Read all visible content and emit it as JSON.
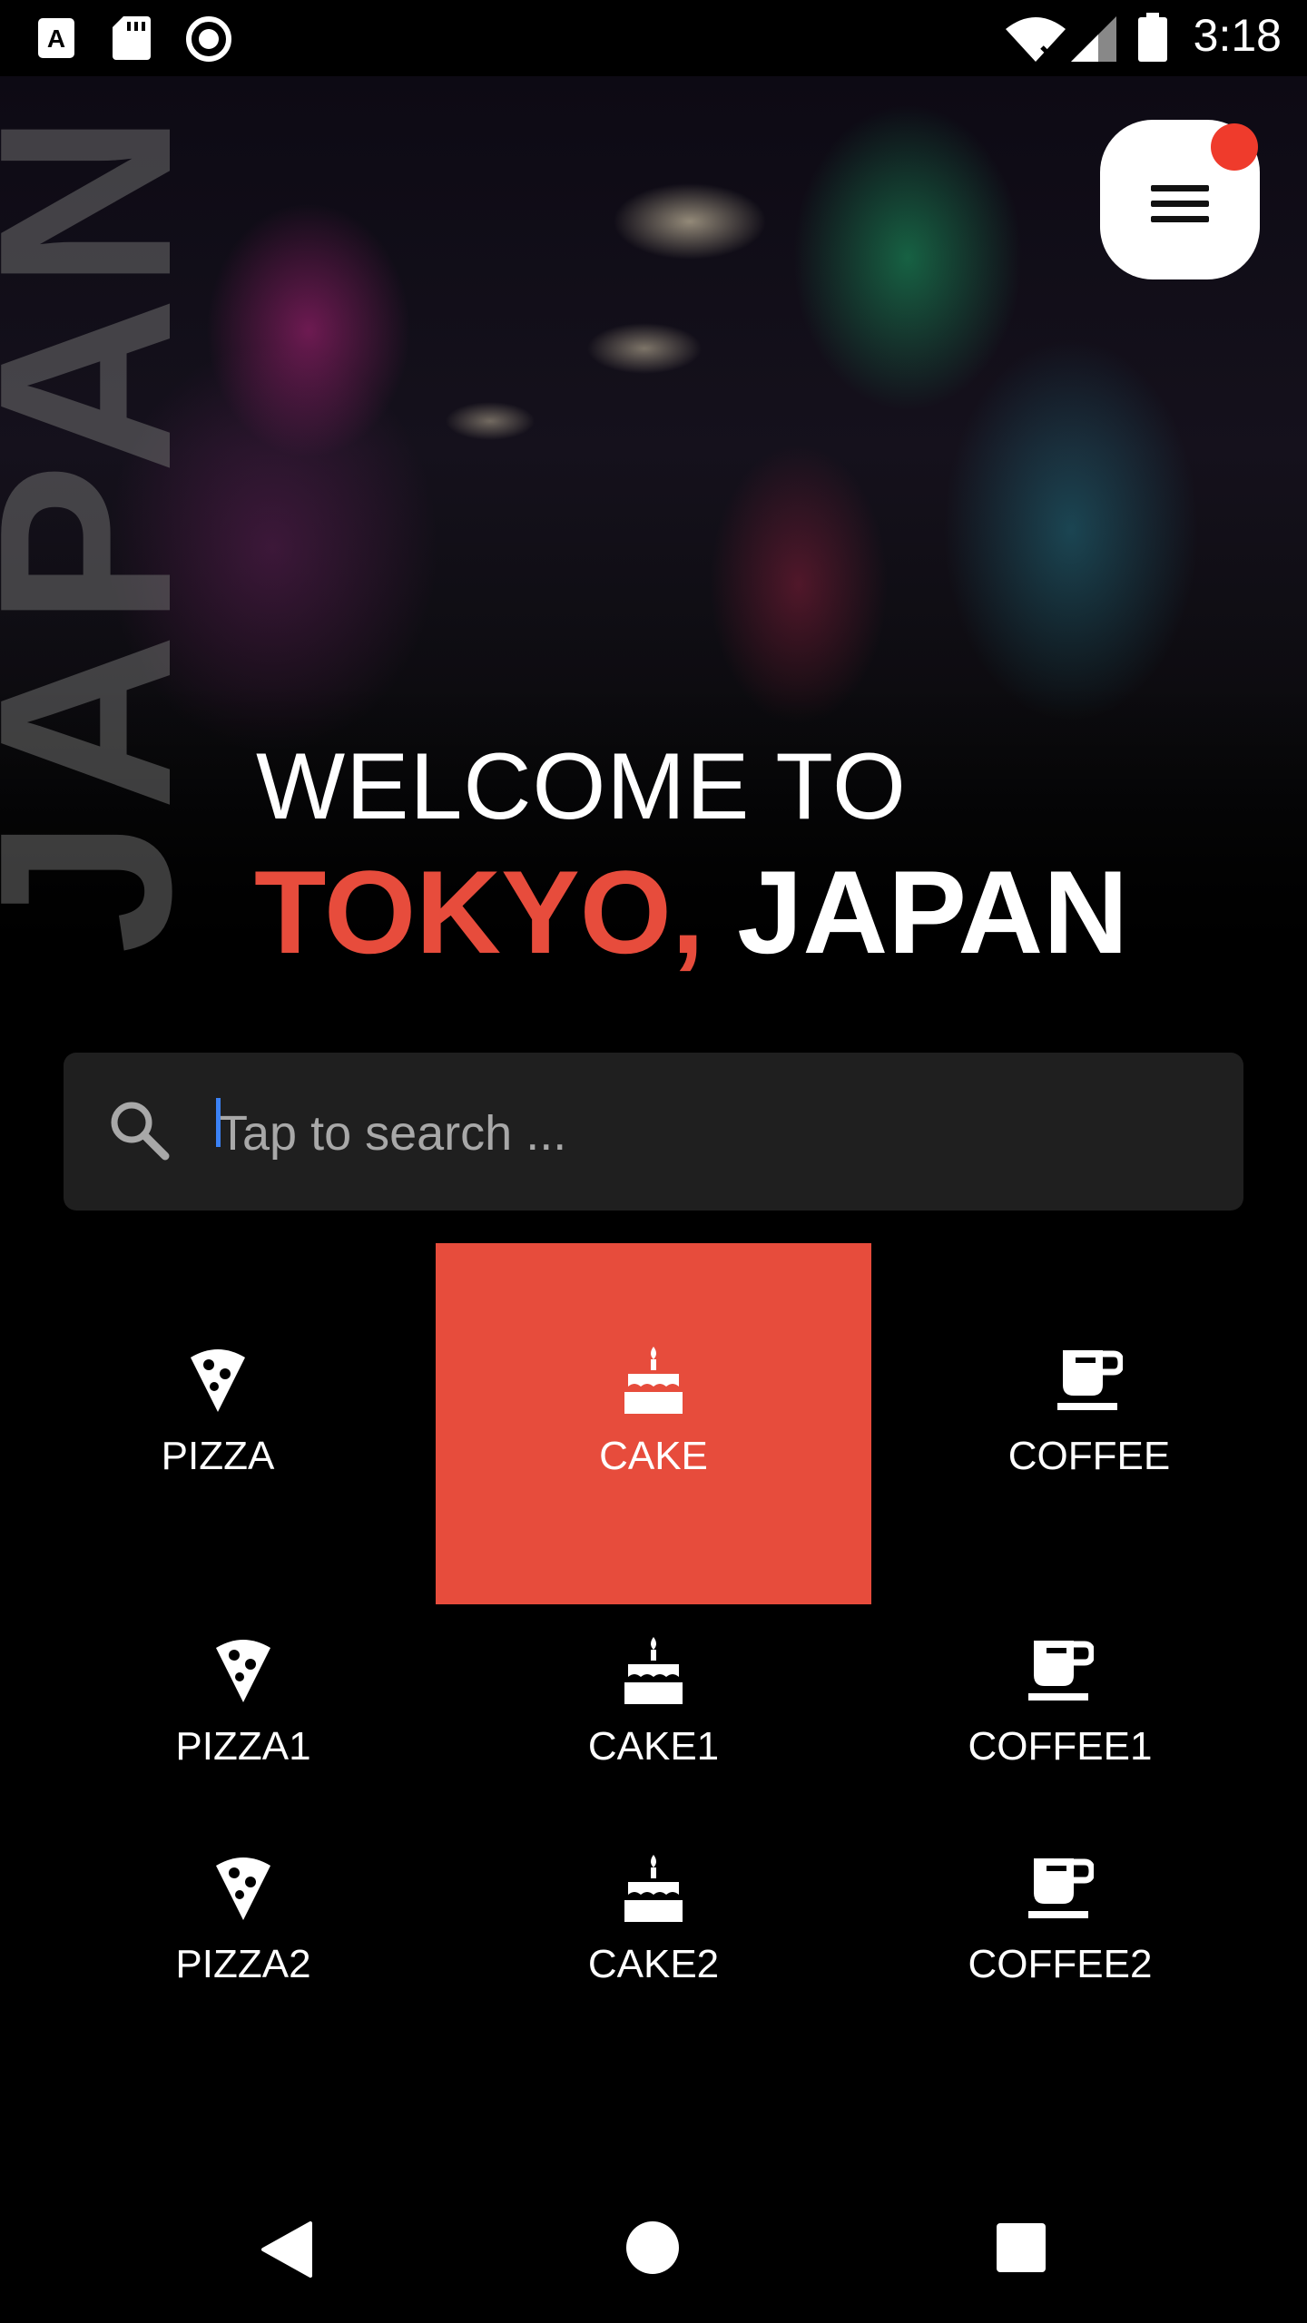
{
  "status_bar": {
    "time": "3:18",
    "icons": [
      "a-notification-icon",
      "sd-card-icon",
      "record-icon",
      "wifi-icon",
      "signal-icon",
      "battery-icon"
    ]
  },
  "hero": {
    "vertical_word": "JAPAN",
    "welcome": "WELCOME TO",
    "city_red": "TOKYO,",
    "city_white": " JAPAN"
  },
  "menu": {
    "icon": "hamburger-icon",
    "notification_color": "#ef3b2c"
  },
  "search": {
    "placeholder": "Tap to search ...",
    "value": ""
  },
  "categories": {
    "row1": [
      {
        "label": "PIZZA",
        "icon": "pizza-icon"
      },
      {
        "label": "CAKE",
        "icon": "cake-icon",
        "selected": true
      },
      {
        "label": "COFFEE",
        "icon": "coffee-icon"
      }
    ],
    "row2": [
      {
        "label": "PIZZA1",
        "icon": "pizza-icon"
      },
      {
        "label": "CAKE1",
        "icon": "cake-icon"
      },
      {
        "label": "COFFEE1",
        "icon": "coffee-icon"
      }
    ],
    "row3": [
      {
        "label": "PIZZA2",
        "icon": "pizza-icon"
      },
      {
        "label": "CAKE2",
        "icon": "cake-icon"
      },
      {
        "label": "COFFEE2",
        "icon": "coffee-icon"
      }
    ]
  },
  "colors": {
    "accent": "#e74c3c",
    "background": "#000000",
    "search_bg": "#1f1f1f"
  },
  "nav_bar": {
    "icons": [
      "back-icon",
      "home-icon",
      "recent-apps-icon"
    ]
  }
}
